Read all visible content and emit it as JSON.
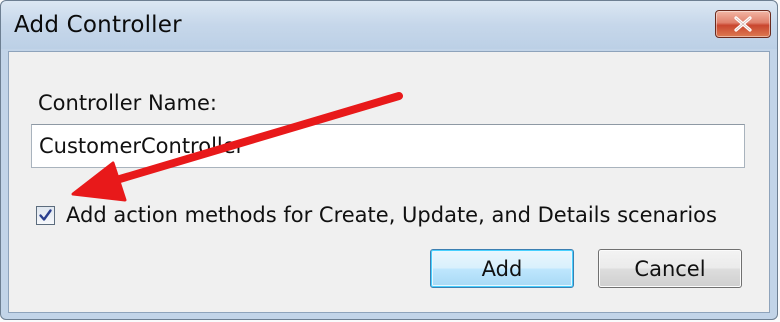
{
  "window": {
    "title": "Add Controller",
    "close_icon": "close-icon"
  },
  "form": {
    "name_label": "Controller Name:",
    "name_value": "CustomerController",
    "checkbox_label": "Add action methods for Create, Update, and Details scenarios",
    "checkbox_checked": true
  },
  "buttons": {
    "add": "Add",
    "cancel": "Cancel"
  },
  "annotation": {
    "arrow_color": "#e8191a"
  }
}
